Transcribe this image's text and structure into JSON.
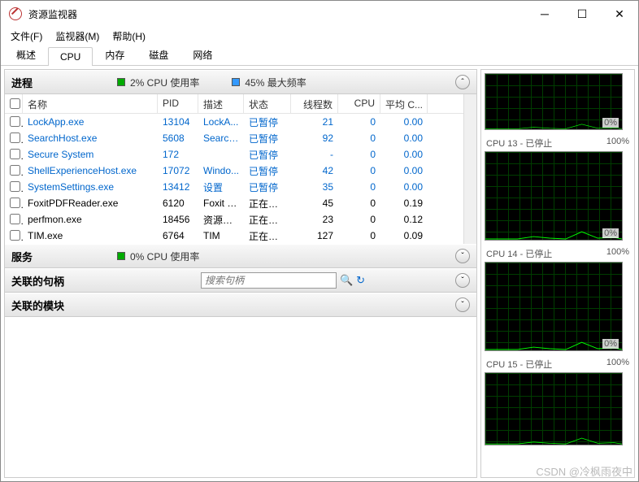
{
  "window": {
    "title": "资源监视器"
  },
  "menu": {
    "file": "文件(F)",
    "monitor": "监视器(M)",
    "help": "帮助(H)"
  },
  "tabs": {
    "overview": "概述",
    "cpu": "CPU",
    "memory": "内存",
    "disk": "磁盘",
    "network": "网络"
  },
  "sections": {
    "processes": {
      "title": "进程",
      "cpu_usage": "2% CPU 使用率",
      "max_freq": "45% 最大频率"
    },
    "services": {
      "title": "服务",
      "cpu_usage": "0% CPU 使用率"
    },
    "handles": {
      "title": "关联的句柄",
      "search_placeholder": "搜索句柄"
    },
    "modules": {
      "title": "关联的模块"
    }
  },
  "columns": {
    "name": "名称",
    "pid": "PID",
    "desc": "描述",
    "status": "状态",
    "threads": "线程数",
    "cpu": "CPU",
    "avg": "平均 C..."
  },
  "rows": [
    {
      "name": "LockApp.exe",
      "pid": "13104",
      "desc": "LockA...",
      "status": "已暂停",
      "threads": "21",
      "cpu": "0",
      "avg": "0.00",
      "blue": true
    },
    {
      "name": "SearchHost.exe",
      "pid": "5608",
      "desc": "Search...",
      "status": "已暂停",
      "threads": "92",
      "cpu": "0",
      "avg": "0.00",
      "blue": true
    },
    {
      "name": "Secure System",
      "pid": "172",
      "desc": "",
      "status": "已暂停",
      "threads": "-",
      "cpu": "0",
      "avg": "0.00",
      "blue": true
    },
    {
      "name": "ShellExperienceHost.exe",
      "pid": "17072",
      "desc": "Windo...",
      "status": "已暂停",
      "threads": "42",
      "cpu": "0",
      "avg": "0.00",
      "blue": true
    },
    {
      "name": "SystemSettings.exe",
      "pid": "13412",
      "desc": "设置",
      "status": "已暂停",
      "threads": "35",
      "cpu": "0",
      "avg": "0.00",
      "blue": true
    },
    {
      "name": "FoxitPDFReader.exe",
      "pid": "6120",
      "desc": "Foxit P...",
      "status": "正在运行",
      "threads": "45",
      "cpu": "0",
      "avg": "0.19",
      "blue": false
    },
    {
      "name": "perfmon.exe",
      "pid": "18456",
      "desc": "资源和...",
      "status": "正在运行",
      "threads": "23",
      "cpu": "0",
      "avg": "0.12",
      "blue": false
    },
    {
      "name": "TIM.exe",
      "pid": "6764",
      "desc": "TIM",
      "status": "正在运行",
      "threads": "127",
      "cpu": "0",
      "avg": "0.09",
      "blue": false
    }
  ],
  "graphs": [
    {
      "label_l": "",
      "label_r": "",
      "pct": "0%"
    },
    {
      "label_l": "CPU 13 - 已停止",
      "label_r": "100%",
      "pct": "0%"
    },
    {
      "label_l": "CPU 14 - 已停止",
      "label_r": "100%",
      "pct": "0%"
    },
    {
      "label_l": "CPU 15 - 已停止",
      "label_r": "100%",
      "pct": ""
    }
  ],
  "watermark": "CSDN @冷枫雨夜中"
}
